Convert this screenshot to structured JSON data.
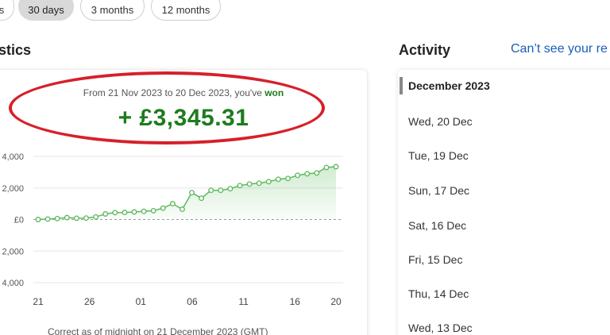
{
  "filters": {
    "partial_label": "s",
    "items": [
      {
        "label": "30 days",
        "active": true
      },
      {
        "label": "3 months",
        "active": false
      },
      {
        "label": "12 months",
        "active": false
      }
    ]
  },
  "statistics": {
    "title_fragment": "stics",
    "summary_prefix": "From 21 Nov 2023 to 20 Dec 2023, you've",
    "summary_won": "won",
    "amount": "+ £3,345.31",
    "footnote": "Correct as of midnight on 21 December 2023 (GMT)"
  },
  "activity": {
    "title": "Activity",
    "help_link": "Can’t see your re",
    "month": "December 2023",
    "days": [
      "Wed, 20 Dec",
      "Tue, 19 Dec",
      "Sun, 17 Dec",
      "Sat, 16 Dec",
      "Fri, 15 Dec",
      "Thu, 14 Dec",
      "Wed, 13 Dec"
    ]
  },
  "colors": {
    "accent_green": "#1e7b1e",
    "line_green": "#5cb85c",
    "highlight_red": "#d6202a",
    "link_blue": "#1a5fb4"
  },
  "chart_data": {
    "type": "line",
    "y_tick_labels": [
      "4,000",
      "2,000",
      "£0",
      "2,000",
      "4,000"
    ],
    "y_ticks": [
      4000,
      2000,
      0,
      -2000,
      -4000
    ],
    "x_tick_labels": [
      "21",
      "26",
      "01",
      "06",
      "11",
      "16",
      "20"
    ],
    "ylim": [
      -4000,
      4000
    ],
    "grid": true,
    "series": [
      {
        "values": [
          0,
          30,
          60,
          120,
          80,
          90,
          160,
          350,
          440,
          450,
          480,
          520,
          560,
          720,
          1000,
          650,
          1700,
          1350,
          1850,
          1850,
          1950,
          2150,
          2250,
          2300,
          2400,
          2550,
          2600,
          2800,
          2900,
          2950,
          3300,
          3345
        ]
      }
    ]
  }
}
